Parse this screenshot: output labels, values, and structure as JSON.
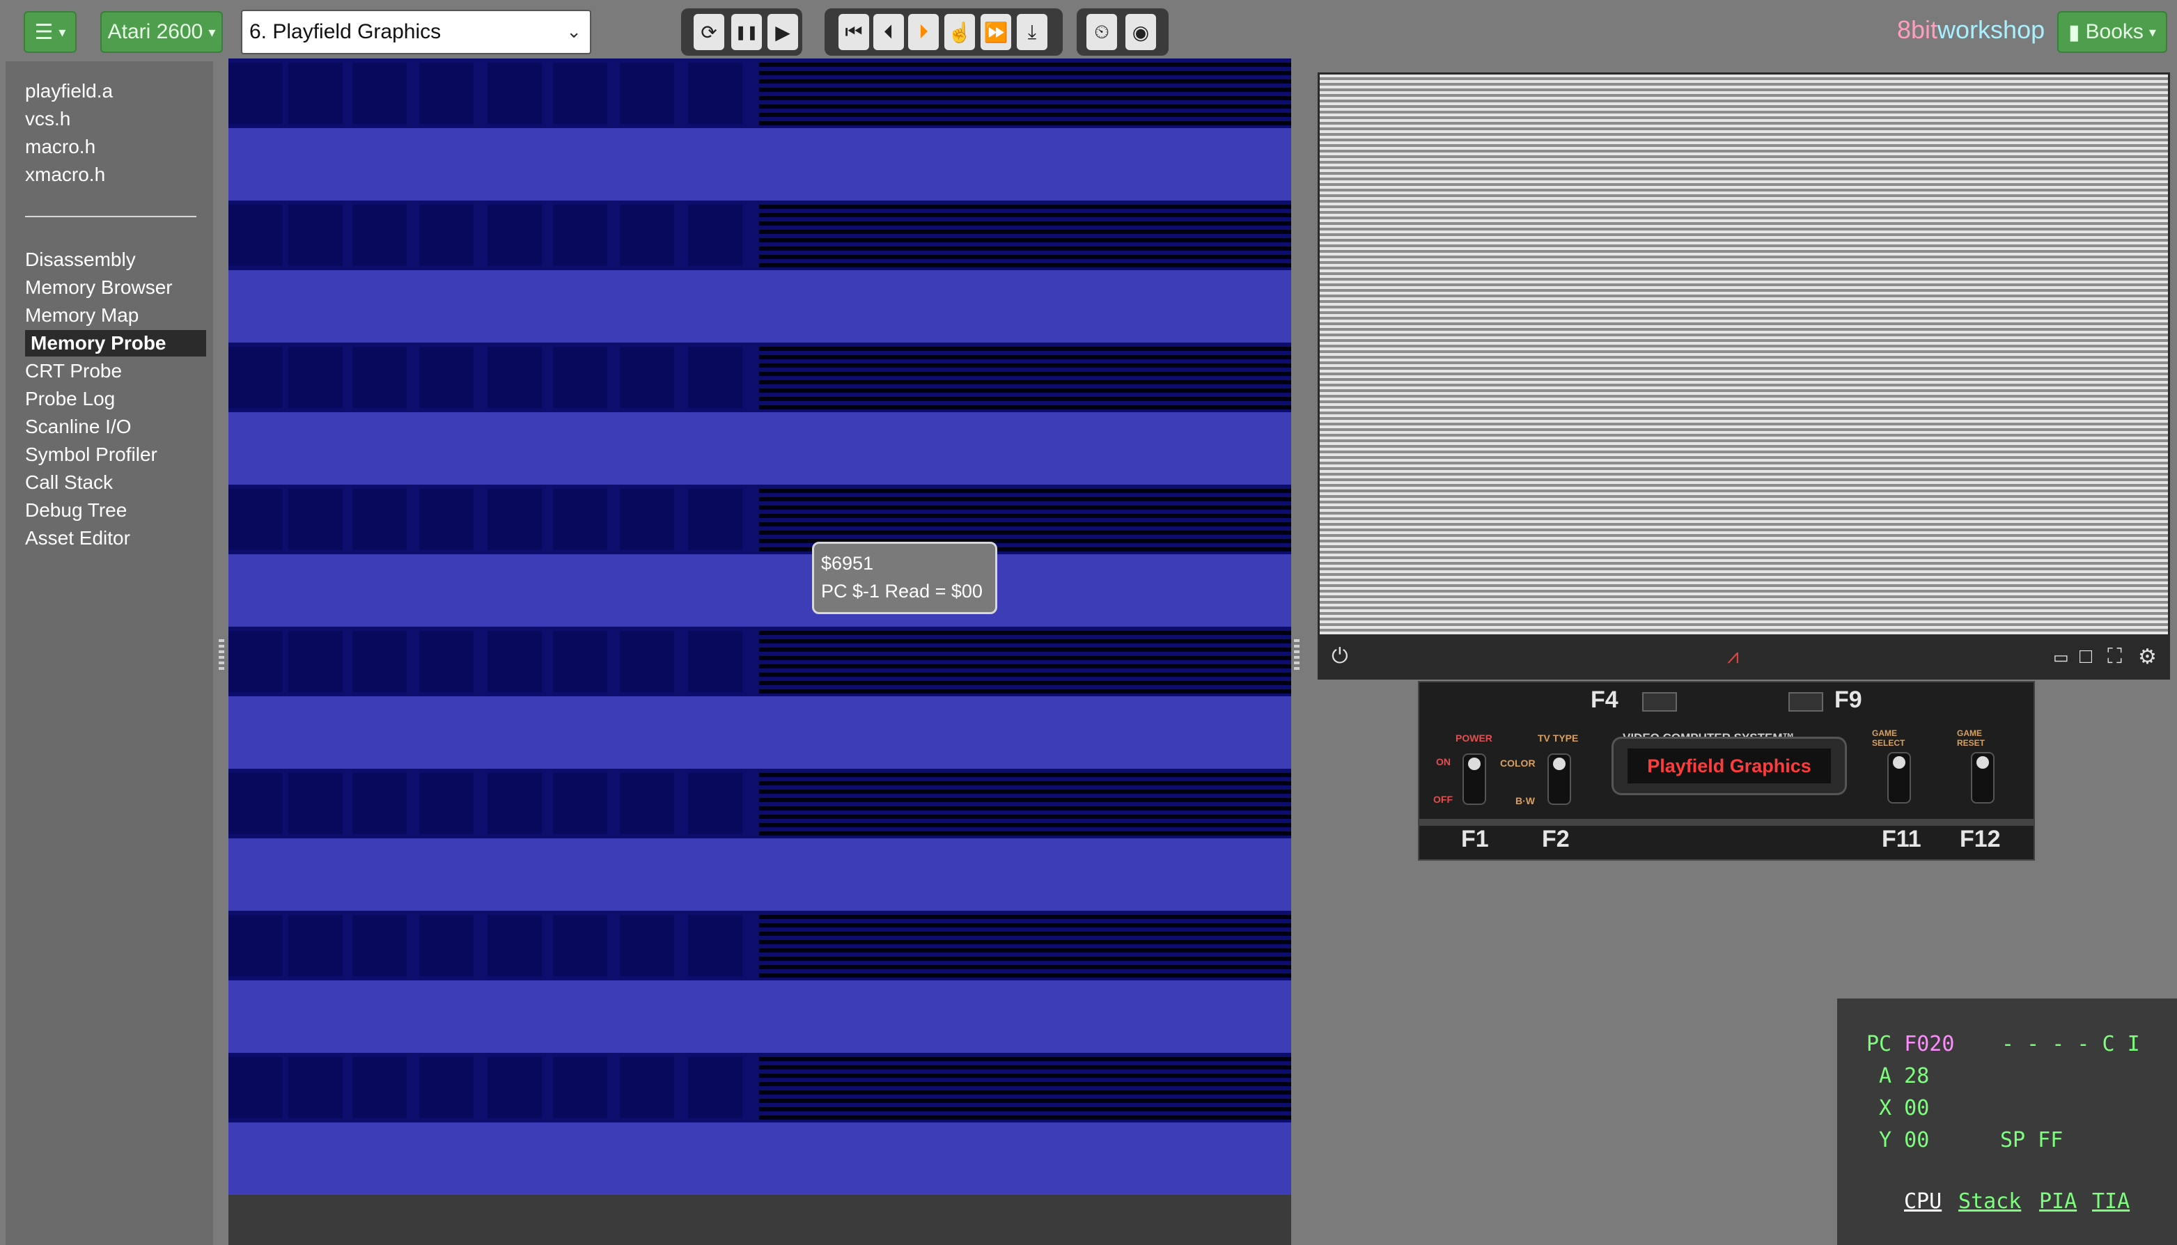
{
  "toolbar": {
    "menu_icon": "hamburger-icon",
    "platform_label": "Atari 2600",
    "preset_label": "6. Playfield Graphics",
    "controls": [
      {
        "name": "reset-button",
        "glyph": "⟳"
      },
      {
        "name": "pause-button",
        "glyph": "❚❚"
      },
      {
        "name": "run-button",
        "glyph": "▶"
      },
      {
        "name": "reset-to-start-button",
        "glyph": "⏮"
      },
      {
        "name": "step-back-button",
        "glyph": "⏴"
      },
      {
        "name": "step-button",
        "glyph": "⏵"
      },
      {
        "name": "step-until-button",
        "glyph": "☝"
      },
      {
        "name": "step-over-button",
        "glyph": "⏩"
      },
      {
        "name": "download-button",
        "glyph": "⤓"
      },
      {
        "name": "record-button",
        "glyph": "⏲"
      },
      {
        "name": "target-button",
        "glyph": "◉"
      }
    ],
    "brand_part1": "8bit",
    "brand_part2": "workshop",
    "books_label": "Books"
  },
  "sidebar": {
    "files": [
      "playfield.a",
      "vcs.h",
      "macro.h",
      "xmacro.h"
    ],
    "tools": [
      "Disassembly",
      "Memory Browser",
      "Memory Map",
      "Memory Probe",
      "CRT Probe",
      "Probe Log",
      "Scanline I/O",
      "Symbol Profiler",
      "Call Stack",
      "Debug Tree",
      "Asset Editor"
    ],
    "selected": "Memory Probe"
  },
  "probe": {
    "tooltip_line1": "$6951",
    "tooltip_line2": "PC $-1 Read = $00",
    "colors": {
      "light": "#3d3db8",
      "dark": "#0d0d6e"
    }
  },
  "emulator": {
    "console_label_left": "F4",
    "console_label_right": "F9",
    "power_label": "POWER",
    "power_on": "ON",
    "power_off": "OFF",
    "tvtype_label": "TV TYPE",
    "color_label": "COLOR",
    "bw_label": "B·W",
    "vcs_label": "VIDEO COMPUTER SYSTEM™",
    "cart_label": "Playfield Graphics",
    "select_label": "GAME SELECT",
    "reset_label": "GAME RESET",
    "f1": "F1",
    "f2": "F2",
    "f11": "F11",
    "f12": "F12"
  },
  "cpu": {
    "line_pc": "PC ",
    "pc_value": "F020",
    "flags": "- - - - C I",
    "line_a": " A 28",
    "line_x": " X 00",
    "line_y": " Y 00",
    "sp": "SP FF",
    "tabs": [
      "CPU",
      "Stack",
      "PIA",
      "TIA"
    ]
  }
}
